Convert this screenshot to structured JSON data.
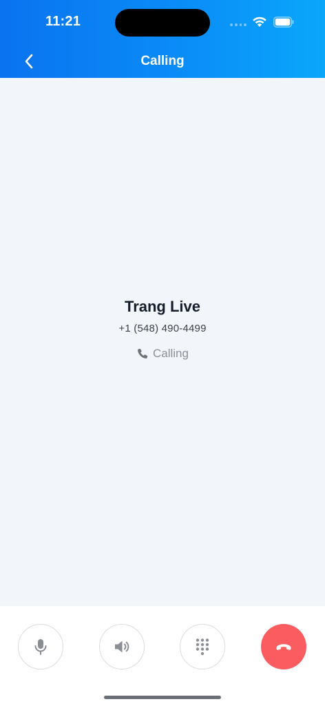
{
  "status_bar": {
    "time": "11:21"
  },
  "header": {
    "title": "Calling",
    "back_icon": "chevron-left-icon"
  },
  "caller": {
    "name": "Trang Live",
    "number": "+1 (548) 490-4499",
    "status": "Calling",
    "status_icon": "phone-icon"
  },
  "controls": [
    {
      "name": "mute",
      "icon": "microphone-icon"
    },
    {
      "name": "speaker",
      "icon": "speaker-icon"
    },
    {
      "name": "keypad",
      "icon": "keypad-icon"
    },
    {
      "name": "end-call",
      "icon": "hang-up-icon"
    }
  ],
  "colors": {
    "header_gradient_start": "#0a73f0",
    "header_gradient_end": "#0aa7fb",
    "end_call": "#fb5c5f",
    "background": "#f2f5fa"
  }
}
